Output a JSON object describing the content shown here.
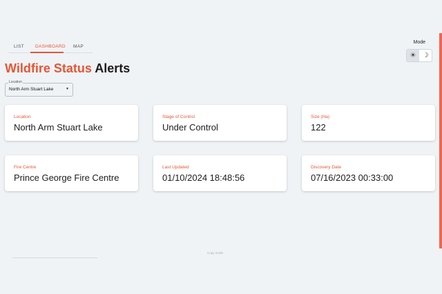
{
  "nav": {
    "tabs": [
      {
        "label": "LIST"
      },
      {
        "label": "DASHBOARD"
      },
      {
        "label": "MAP"
      }
    ],
    "active_tab": "DASHBOARD"
  },
  "mode": {
    "label": "Mode",
    "options": [
      {
        "icon": "sun-icon",
        "glyph": "☀"
      },
      {
        "icon": "moon-icon",
        "glyph": "☽"
      }
    ],
    "selected": "sun-icon"
  },
  "header": {
    "title_accent": "Wildfire Status",
    "title_rest": "Alerts"
  },
  "location_select": {
    "legend": "Location",
    "value": "North Arm Stuart Lake",
    "caret": "▼"
  },
  "cards": [
    {
      "label": "Location",
      "value": "North Arm Stuart Lake"
    },
    {
      "label": "Stage of Control",
      "value": "Under Control"
    },
    {
      "label": "Size (Ha)",
      "value": "122"
    },
    {
      "label": "Fire Centre",
      "value": "Prince George Fire Centre"
    },
    {
      "label": "Last Updated",
      "value": "01/10/2024 18:48:56"
    },
    {
      "label": "Discovery Date",
      "value": "07/16/2023 00:33:00"
    }
  ],
  "footer": {
    "text": "Copy mode"
  },
  "colors": {
    "accent": "#e85535",
    "background": "#eff3f6",
    "scroll_accent": "#f0674d"
  }
}
